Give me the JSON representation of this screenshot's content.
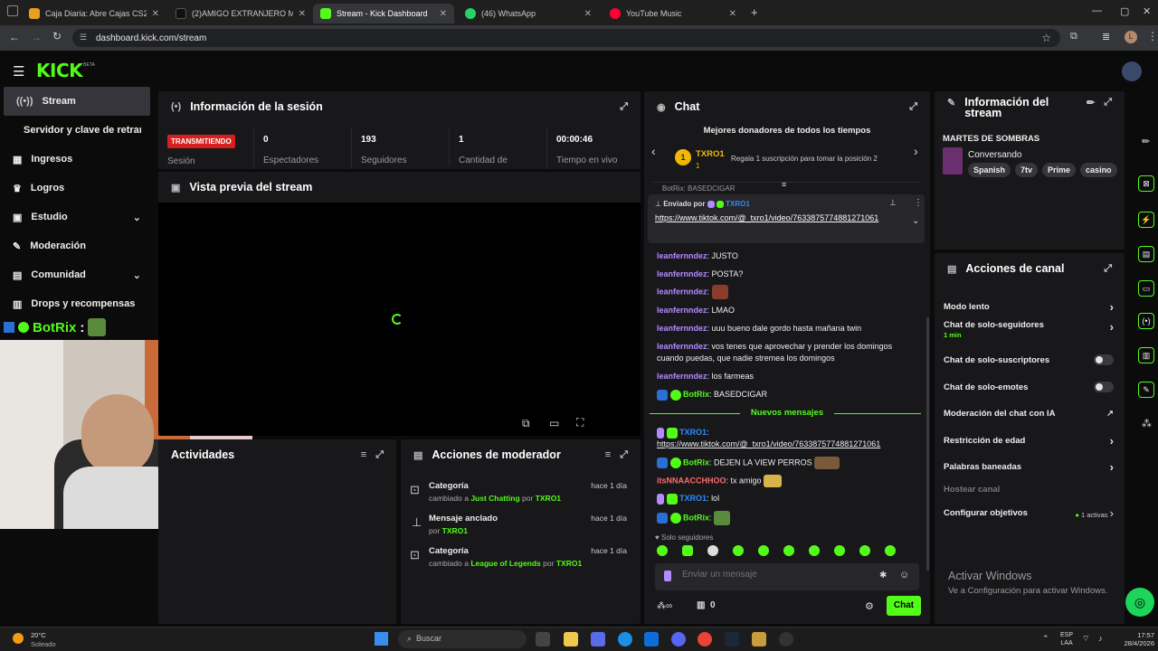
{
  "browser": {
    "tabs": [
      {
        "label": "Caja Diaria: Abre Cajas CS2 (CS",
        "active": false
      },
      {
        "label": "(2)AMIGO EXTRANJERO ME HA",
        "active": false
      },
      {
        "label": "Stream - Kick Dashboard",
        "active": true
      },
      {
        "label": "(46) WhatsApp",
        "active": false
      },
      {
        "label": "YouTube Music",
        "active": false
      }
    ],
    "url": "dashboard.kick.com/stream",
    "profile_initial": "L"
  },
  "app": {
    "logo": "KICK",
    "logo_badge": "BETA",
    "accent": "#53fc18"
  },
  "sidebar": {
    "items": [
      {
        "label": "Stream",
        "icon": "signal-icon",
        "active": true
      },
      {
        "label": "Servidor y clave de retransn",
        "icon": "",
        "active": false
      },
      {
        "label": "Ingresos",
        "icon": "chart-icon",
        "active": false
      },
      {
        "label": "Logros",
        "icon": "trophy-icon",
        "active": false
      },
      {
        "label": "Estudio",
        "icon": "studio-icon",
        "active": false,
        "expandable": true
      },
      {
        "label": "Moderación",
        "icon": "wrench-icon",
        "active": false
      },
      {
        "label": "Comunidad",
        "icon": "community-icon",
        "active": false,
        "expandable": true
      },
      {
        "label": "Drops y recompensas",
        "icon": "gift-icon",
        "active": false
      }
    ]
  },
  "overlay": {
    "bot_name": "BotRix",
    "colon": ":"
  },
  "session": {
    "title": "Información de la sesión",
    "status_badge": "TRANSMITIENDO",
    "session_label": "Sesión",
    "stats": [
      {
        "value": "0",
        "label": "Espectadores"
      },
      {
        "value": "193",
        "label": "Seguidores"
      },
      {
        "value": "1",
        "label": "Cantidad de suscripciones"
      },
      {
        "value": "00:00:46",
        "label": "Tiempo en vivo"
      }
    ]
  },
  "preview": {
    "title": "Vista previa del stream"
  },
  "activity": {
    "title": "Actividades"
  },
  "mod_actions": {
    "title": "Acciones de moderador",
    "items": [
      {
        "title": "Categoría",
        "pre": "cambiado a",
        "target": "Just Chatting",
        "by_word": "por",
        "user": "TXRO1",
        "time": "hace 1 día",
        "icon": "category-icon"
      },
      {
        "title": "Mensaje anclado",
        "pre": "",
        "target": "",
        "by_word": "por",
        "user": "TXRO1",
        "time": "hace 1 día",
        "icon": "pin-icon"
      },
      {
        "title": "Categoría",
        "pre": "cambiado a",
        "target": "League of Legends",
        "by_word": "por",
        "user": "TXRO1",
        "time": "hace 1 día",
        "icon": "category-icon"
      }
    ]
  },
  "chat": {
    "title": "Chat",
    "top_donors_title": "Mejores donadores de todos los tiempos",
    "donor_rank": "1",
    "donor_name": "TXRO1",
    "donor_count": "1",
    "gift_prompt": "Regala 1 suscripción para tomar la posición 2",
    "partial_top": "BotRix: BASEDCIGAR",
    "pinned_prefix": "Enviado por",
    "pinned_user": "TXRO1",
    "pinned_link": "https://www.tiktok.com/@_txro1/video/7633875774881271061",
    "messages": [
      {
        "user": "leanfernndez",
        "text": "JUSTO"
      },
      {
        "user": "leanfernndez",
        "text": "POSTA?"
      },
      {
        "user": "leanfernndez",
        "text": ""
      },
      {
        "user": "leanfernndez",
        "text": "LMAO"
      },
      {
        "user": "leanfernndez",
        "text": "uuu bueno dale gordo hasta mañana twin"
      },
      {
        "user": "leanfernndez",
        "text": "vos tenes que aprovechar y prender los domingos"
      },
      {
        "user": "",
        "text": "cuando puedas, que nadie stremea los domingos"
      },
      {
        "user": "leanfernndez",
        "text": "los farmeas"
      },
      {
        "user": "BotRix",
        "text": "BASEDCIGAR"
      }
    ],
    "new_messages_label": "Nuevos mensajes",
    "new_messages": [
      {
        "user": "TXRO1",
        "text": ""
      },
      {
        "user": "",
        "text": "https://www.tiktok.com/@_txro1/video/7633875774881271061"
      },
      {
        "user": "BotRix",
        "text": "DEJEN LA VIEW PERROS"
      },
      {
        "user": "itsNNAACCHHOO",
        "text": "tx amigo"
      },
      {
        "user": "TXRO1",
        "text": "lol"
      },
      {
        "user": "BotRix",
        "text": ""
      }
    ],
    "followers_only": "Solo seguidores",
    "input_placeholder": "Enviar un mensaje",
    "footer_count": "0",
    "send_button": "Chat"
  },
  "stream_info": {
    "title": "Información del stream",
    "stream_title": "MARTES DE SOMBRAS",
    "category": "Conversando",
    "tags": [
      "Spanish",
      "7tv",
      "Prime",
      "casino"
    ]
  },
  "channel_actions": {
    "title": "Acciones de canal",
    "rows": [
      {
        "label": "Modo lento",
        "sub": "",
        "control": "chevron"
      },
      {
        "label": "Chat de solo-seguidores",
        "sub": "1 min",
        "control": "chevron"
      },
      {
        "label": "Chat de solo-suscriptores",
        "sub": "",
        "control": "toggle"
      },
      {
        "label": "Chat de solo-emotes",
        "sub": "",
        "control": "toggle"
      },
      {
        "label": "Moderación del chat con IA",
        "sub": "",
        "control": "external"
      },
      {
        "label": "Restricción de edad",
        "sub": "",
        "control": "chevron"
      },
      {
        "label": "Palabras baneadas",
        "sub": "",
        "control": "chevron"
      },
      {
        "label": "Hostear canal",
        "sub": "",
        "control": "none",
        "disabled": true
      },
      {
        "label": "Configurar objetivos",
        "sub": "1 activas",
        "control": "chevron"
      }
    ]
  },
  "windows_watermark": {
    "line1": "Activar Windows",
    "line2": "Ve a Configuración para activar Windows."
  },
  "taskbar": {
    "weather_temp": "20°C",
    "weather_desc": "Soleado",
    "search_placeholder": "Buscar",
    "lang_line1": "ESP",
    "lang_line2": "LAA",
    "time": "17:57",
    "date": "28/4/2026"
  }
}
